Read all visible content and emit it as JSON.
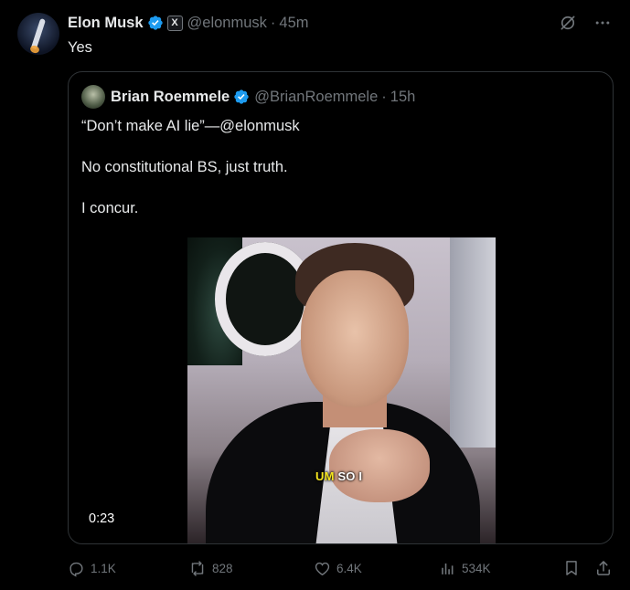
{
  "tweet": {
    "author_name": "Elon Musk",
    "author_handle": "@elonmusk",
    "separator": "·",
    "time": "45m",
    "badge_letter": "X",
    "text": "Yes"
  },
  "quote": {
    "author_name": "Brian Roemmele",
    "author_handle": "@BrianRoemmele",
    "separator": "·",
    "time": "15h",
    "paragraphs": [
      "“Don’t make AI lie”—@elonmusk",
      "No constitutional BS, just truth.",
      "I concur."
    ],
    "video": {
      "caption_highlight": "UM",
      "caption_rest": "SO I",
      "duration": "0:23"
    }
  },
  "actions": {
    "replies": "1.1K",
    "reposts": "828",
    "likes": "6.4K",
    "views": "534K"
  },
  "icons": {
    "verified_color": "#1d9bf0",
    "top_right": [
      "grok-icon",
      "more-icon"
    ],
    "action_bar": [
      "reply-icon",
      "repost-icon",
      "like-icon",
      "views-icon",
      "bookmark-icon",
      "share-icon"
    ]
  }
}
